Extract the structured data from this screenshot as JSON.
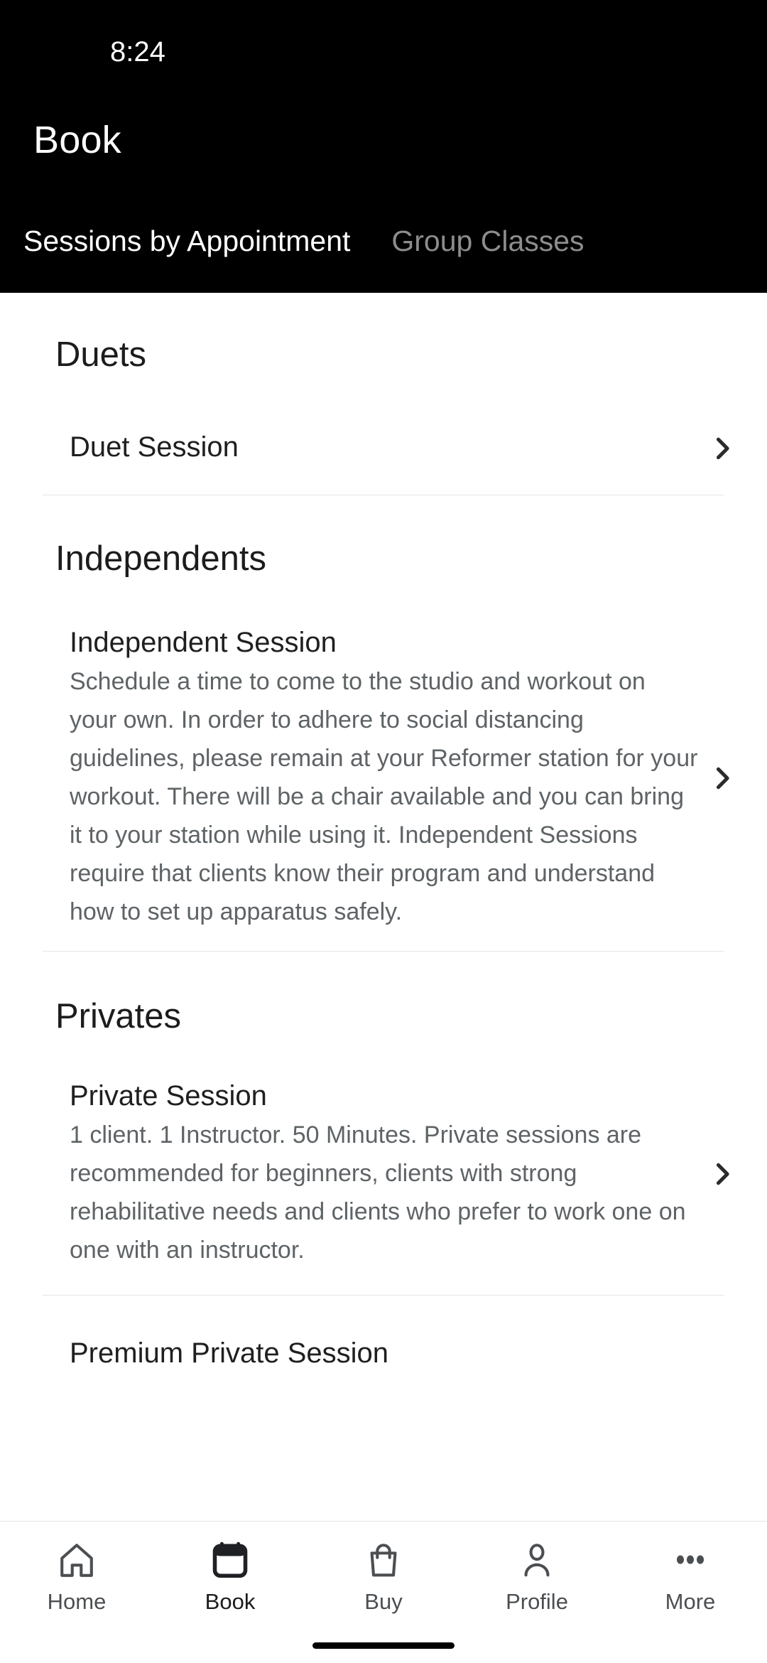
{
  "status_bar": {
    "time": "8:24"
  },
  "header": {
    "title": "Book",
    "tabs": [
      {
        "label": "Sessions by Appointment",
        "active": true
      },
      {
        "label": "Group Classes",
        "active": false
      }
    ]
  },
  "content": {
    "sections": [
      {
        "header": "Duets",
        "items": [
          {
            "title": "Duet Session",
            "description": ""
          }
        ]
      },
      {
        "header": "Independents",
        "items": [
          {
            "title": "Independent Session",
            "description": "Schedule a time to come to the studio and workout on your own. In order to adhere to social distancing guidelines, please remain at your Reformer station for your workout.  There will be a chair available and you can bring it to your station while using it. Independent Sessions require that clients know their program and understand how to set up apparatus safely."
          }
        ]
      },
      {
        "header": "Privates",
        "items": [
          {
            "title": "Private Session",
            "description": "1 client. 1 Instructor. 50 Minutes.   Private sessions are recommended for beginners, clients with strong rehabilitative needs and clients who prefer to work one on one with an instructor."
          },
          {
            "title": "Premium Private Session",
            "description": ""
          }
        ]
      }
    ],
    "chevron_icon": "chevron-right-icon"
  },
  "bottom_nav": {
    "items": [
      {
        "label": "Home",
        "icon": "home-icon",
        "active": false
      },
      {
        "label": "Book",
        "icon": "calendar-icon",
        "active": true
      },
      {
        "label": "Buy",
        "icon": "shopping-bag-icon",
        "active": false
      },
      {
        "label": "Profile",
        "icon": "person-icon",
        "active": false
      },
      {
        "label": "More",
        "icon": "more-dots-icon",
        "active": false
      }
    ]
  },
  "colors": {
    "header_bg": "#000000",
    "page_bg": "#ffffff",
    "tab_active": "#ffffff",
    "tab_inactive": "#8d8d8d",
    "title_text": "#1f1f1f",
    "body_text": "#5e6366",
    "divider": "#e6e6e6"
  }
}
